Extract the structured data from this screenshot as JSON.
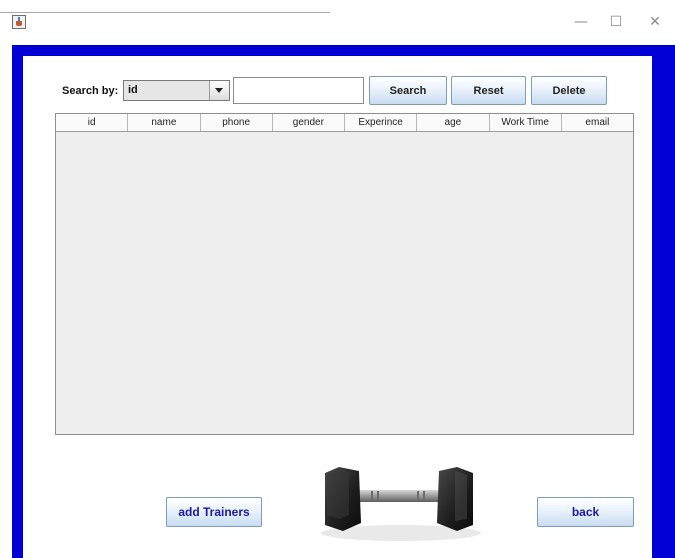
{
  "window": {
    "minimize_glyph": "—",
    "maximize_glyph": "☐",
    "close_glyph": "✕"
  },
  "search": {
    "label": "Search by:",
    "field_selected": "id",
    "input_value": "",
    "search_label": "Search",
    "reset_label": "Reset",
    "delete_label": "Delete"
  },
  "table": {
    "columns": [
      "id",
      "name",
      "phone",
      "gender",
      "Experince",
      "age",
      "Work Time",
      "email"
    ],
    "rows": []
  },
  "footer": {
    "add_label": "add Trainers",
    "back_label": "back"
  },
  "colors": {
    "frame_blue": "#0000d6",
    "button_text_blue": "#1a1aa6",
    "table_bg": "#eeeeee"
  },
  "icons": {
    "app": "java-app-icon",
    "image": "dumbbell-image"
  }
}
